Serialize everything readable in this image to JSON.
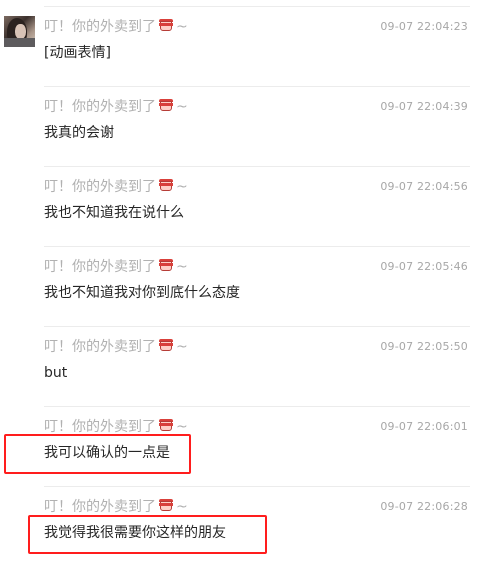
{
  "messages": [
    {
      "sender_name": "叮！你的外卖到了",
      "sender_icon": "delivery-bucket-icon",
      "sender_suffix": "~",
      "time": "09-07 22:04:23",
      "content": "[动画表情]"
    },
    {
      "sender_name": "叮！你的外卖到了",
      "sender_icon": "delivery-bucket-icon",
      "sender_suffix": "~",
      "time": "09-07 22:04:39",
      "content": "我真的会谢"
    },
    {
      "sender_name": "叮！你的外卖到了",
      "sender_icon": "delivery-bucket-icon",
      "sender_suffix": "~",
      "time": "09-07 22:04:56",
      "content": "我也不知道我在说什么"
    },
    {
      "sender_name": "叮！你的外卖到了",
      "sender_icon": "delivery-bucket-icon",
      "sender_suffix": "~",
      "time": "09-07 22:05:46",
      "content": "我也不知道我对你到底什么态度"
    },
    {
      "sender_name": "叮！你的外卖到了",
      "sender_icon": "delivery-bucket-icon",
      "sender_suffix": "~",
      "time": "09-07 22:05:50",
      "content": "but"
    },
    {
      "sender_name": "叮！你的外卖到了",
      "sender_icon": "delivery-bucket-icon",
      "sender_suffix": "~",
      "time": "09-07 22:06:01",
      "content": "我可以确认的一点是"
    },
    {
      "sender_name": "叮！你的外卖到了",
      "sender_icon": "delivery-bucket-icon",
      "sender_suffix": "~",
      "time": "09-07 22:06:28",
      "content": "我觉得我很需要你这样的朋友"
    }
  ],
  "colors": {
    "highlight": "#ff1d1d",
    "sender_text": "#b1b1b1",
    "time_text": "#a7a7a7",
    "message_text": "#262626",
    "divider": "#ececec"
  }
}
